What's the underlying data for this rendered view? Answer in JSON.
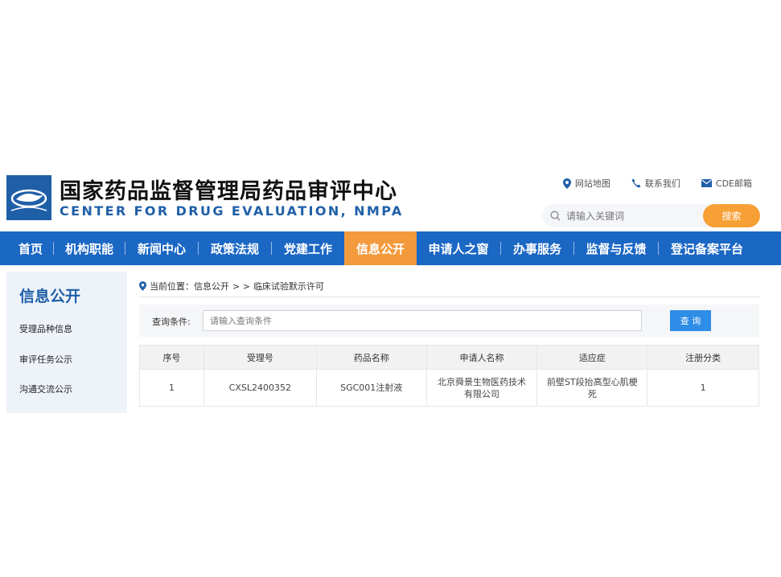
{
  "header": {
    "title_cn": "国家药品监督管理局药品审评中心",
    "title_en": "CENTER FOR DRUG EVALUATION, NMPA",
    "top_links": [
      {
        "label": "网站地图",
        "icon": "location-pin-icon"
      },
      {
        "label": "联系我们",
        "icon": "phone-icon"
      },
      {
        "label": "CDE邮箱",
        "icon": "mail-icon"
      }
    ],
    "search": {
      "placeholder": "请输入关键词",
      "button_label": "搜索"
    }
  },
  "nav": {
    "items": [
      {
        "label": "首页",
        "active": false
      },
      {
        "label": "机构职能",
        "active": false
      },
      {
        "label": "新闻中心",
        "active": false
      },
      {
        "label": "政策法规",
        "active": false
      },
      {
        "label": "党建工作",
        "active": false
      },
      {
        "label": "信息公开",
        "active": true
      },
      {
        "label": "申请人之窗",
        "active": false
      },
      {
        "label": "办事服务",
        "active": false
      },
      {
        "label": "监督与反馈",
        "active": false
      },
      {
        "label": "登记备案平台",
        "active": false
      }
    ]
  },
  "sidebar": {
    "title": "信息公开",
    "items": [
      {
        "label": "受理品种信息"
      },
      {
        "label": "审评任务公示"
      },
      {
        "label": "沟通交流公示"
      }
    ]
  },
  "breadcrumb": {
    "prefix": "当前位置：信息公开",
    "separator": "> >",
    "current": "临床试验默示许可"
  },
  "query": {
    "label": "查询条件:",
    "placeholder": "请输入查询条件",
    "button_label": "查 询"
  },
  "table": {
    "headers": [
      "序号",
      "受理号",
      "药品名称",
      "申请人名称",
      "适应症",
      "注册分类"
    ],
    "rows": [
      [
        "1",
        "CXSL2400352",
        "SGC001注射液",
        "北京舜景生物医药技术有限公司",
        "前壁ST段抬高型心肌梗死",
        "1"
      ]
    ]
  },
  "colors": {
    "brand_blue": "#1b67c4",
    "nav_active": "#f39a3c",
    "search_button": "#f7a035",
    "query_button": "#2e8de6"
  }
}
